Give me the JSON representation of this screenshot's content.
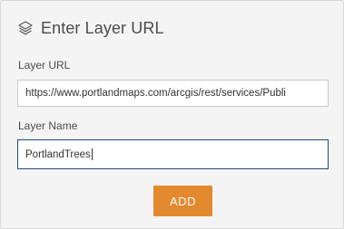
{
  "header": {
    "icon": "layers-icon",
    "title": "Enter Layer URL"
  },
  "form": {
    "layer_url": {
      "label": "Layer URL",
      "value": "https://www.portlandmaps.com/arcgis/rest/services/Publi"
    },
    "layer_name": {
      "label": "Layer Name",
      "value": "PortlandTrees"
    },
    "add_label": "ADD"
  },
  "colors": {
    "panel_bg": "#f4f4f4",
    "accent_button": "#e48a2e",
    "focus_border": "#1f4b7a",
    "text": "#4c4c4c"
  }
}
